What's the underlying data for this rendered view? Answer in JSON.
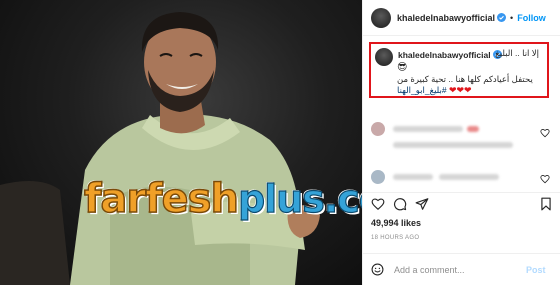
{
  "post": {
    "username": "khaledelnabawyofficial",
    "follow_label": "Follow",
    "separator": "•"
  },
  "caption": {
    "username": "khaledelnabawyofficial",
    "line1": "إلا انا .. البليغ",
    "emoji": "😎",
    "line3": "يحتفل أعيادكم كلها هنا .. تحية كبيرة من",
    "hashtag": "#بليغ_ابو_الهنا",
    "hearts": "❤❤❤"
  },
  "watermark": {
    "main": "farfesh",
    "plus": "plus",
    "com": ".com"
  },
  "engagement": {
    "likes": "49,994 likes",
    "timestamp": "18 HOURS AGO"
  },
  "add_comment": {
    "placeholder": "Add a comment...",
    "post_label": "Post"
  },
  "icons": {
    "verified": "verified-badge-icon",
    "heart": "heart-icon",
    "comment": "comment-icon",
    "share": "share-icon",
    "save": "bookmark-icon",
    "emoji": "emoji-icon"
  },
  "colors": {
    "follow": "#0095f6",
    "highlight_box": "#e0151b",
    "verified": "#3897f0",
    "hashtag": "#00376b"
  }
}
